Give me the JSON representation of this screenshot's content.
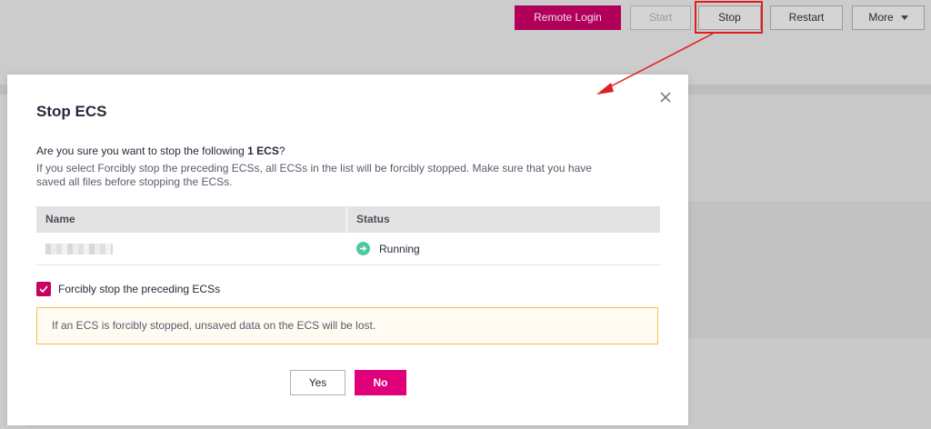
{
  "toolbar": {
    "remote_login": "Remote Login",
    "start": "Start",
    "stop": "Stop",
    "restart": "Restart",
    "more": "More"
  },
  "dialog": {
    "title": "Stop ECS",
    "question_prefix": "Are you sure you want to stop the following ",
    "question_count": "1 ECS",
    "question_suffix": "?",
    "note": "If you select Forcibly stop the preceding ECSs, all ECSs in the list will be forcibly stopped. Make sure that you have saved all files before stopping the ECSs.",
    "table": {
      "headers": [
        "Name",
        "Status"
      ],
      "rows": [
        {
          "name": "",
          "status": "Running"
        }
      ]
    },
    "force_stop_label": "Forcibly stop the preceding ECSs",
    "force_stop_checked": true,
    "warning": "If an ECS is forcibly stopped, unsaved data on the ECS will be lost.",
    "yes_label": "Yes",
    "no_label": "No"
  },
  "colors": {
    "brand": "#e0007a",
    "status_running": "#4ec9a0",
    "annotation": "#e02020",
    "warning_border": "#f0c24a"
  }
}
